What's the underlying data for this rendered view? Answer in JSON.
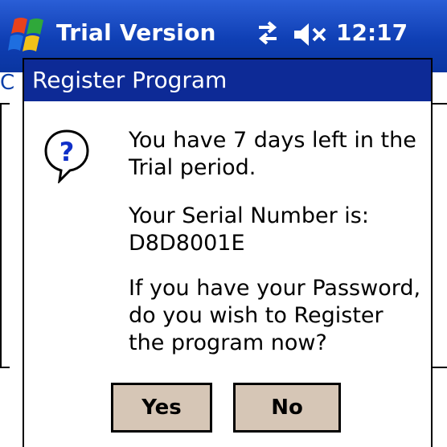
{
  "taskbar": {
    "start_icon": "windows-flag-icon",
    "title": "Trial Version",
    "connectivity_icon": "connectivity-icon",
    "volume_icon": "volume-muted-icon",
    "time": "12:17"
  },
  "background": {
    "partial_label": "C"
  },
  "dialog": {
    "title": "Register Program",
    "icon": "question-icon",
    "message_1": [
      "You have 7 days left in the",
      "Trial period."
    ],
    "message_2": [
      "Your Serial Number is:",
      "D8D8001E"
    ],
    "message_3": [
      "If you have your Password,",
      "do you wish to Register",
      "the program now?"
    ],
    "yes_label": "Yes",
    "no_label": "No"
  },
  "colors": {
    "taskbar_blue": "#0f3fb4",
    "dialog_header": "#0d2a96",
    "button_face": "#d6c6b6"
  }
}
